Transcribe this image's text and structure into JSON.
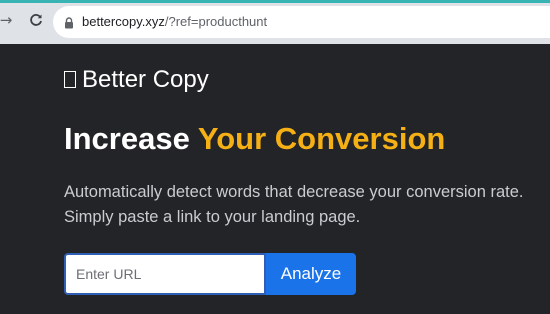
{
  "browser": {
    "url_host": "bettercopy.xyz",
    "url_rest": "/?ref=producthunt",
    "icons": [
      "forward-icon",
      "reload-icon",
      "lock-icon"
    ]
  },
  "header": {
    "brand_name": "Better Copy",
    "brand_icon": "missing-glyph-icon"
  },
  "hero": {
    "headline_plain": "Increase ",
    "headline_accent": "Your Conversion",
    "description_line1": "Automatically detect words that decrease your conversion rate.",
    "description_line2": "Simply paste a link to your landing page."
  },
  "form": {
    "url_placeholder": "Enter URL",
    "url_value": "",
    "analyze_label": "Analyze"
  },
  "colors": {
    "background": "#222427",
    "accent": "#f5b015",
    "button": "#1a73e8",
    "browser_chrome": "#dfe3e8"
  }
}
